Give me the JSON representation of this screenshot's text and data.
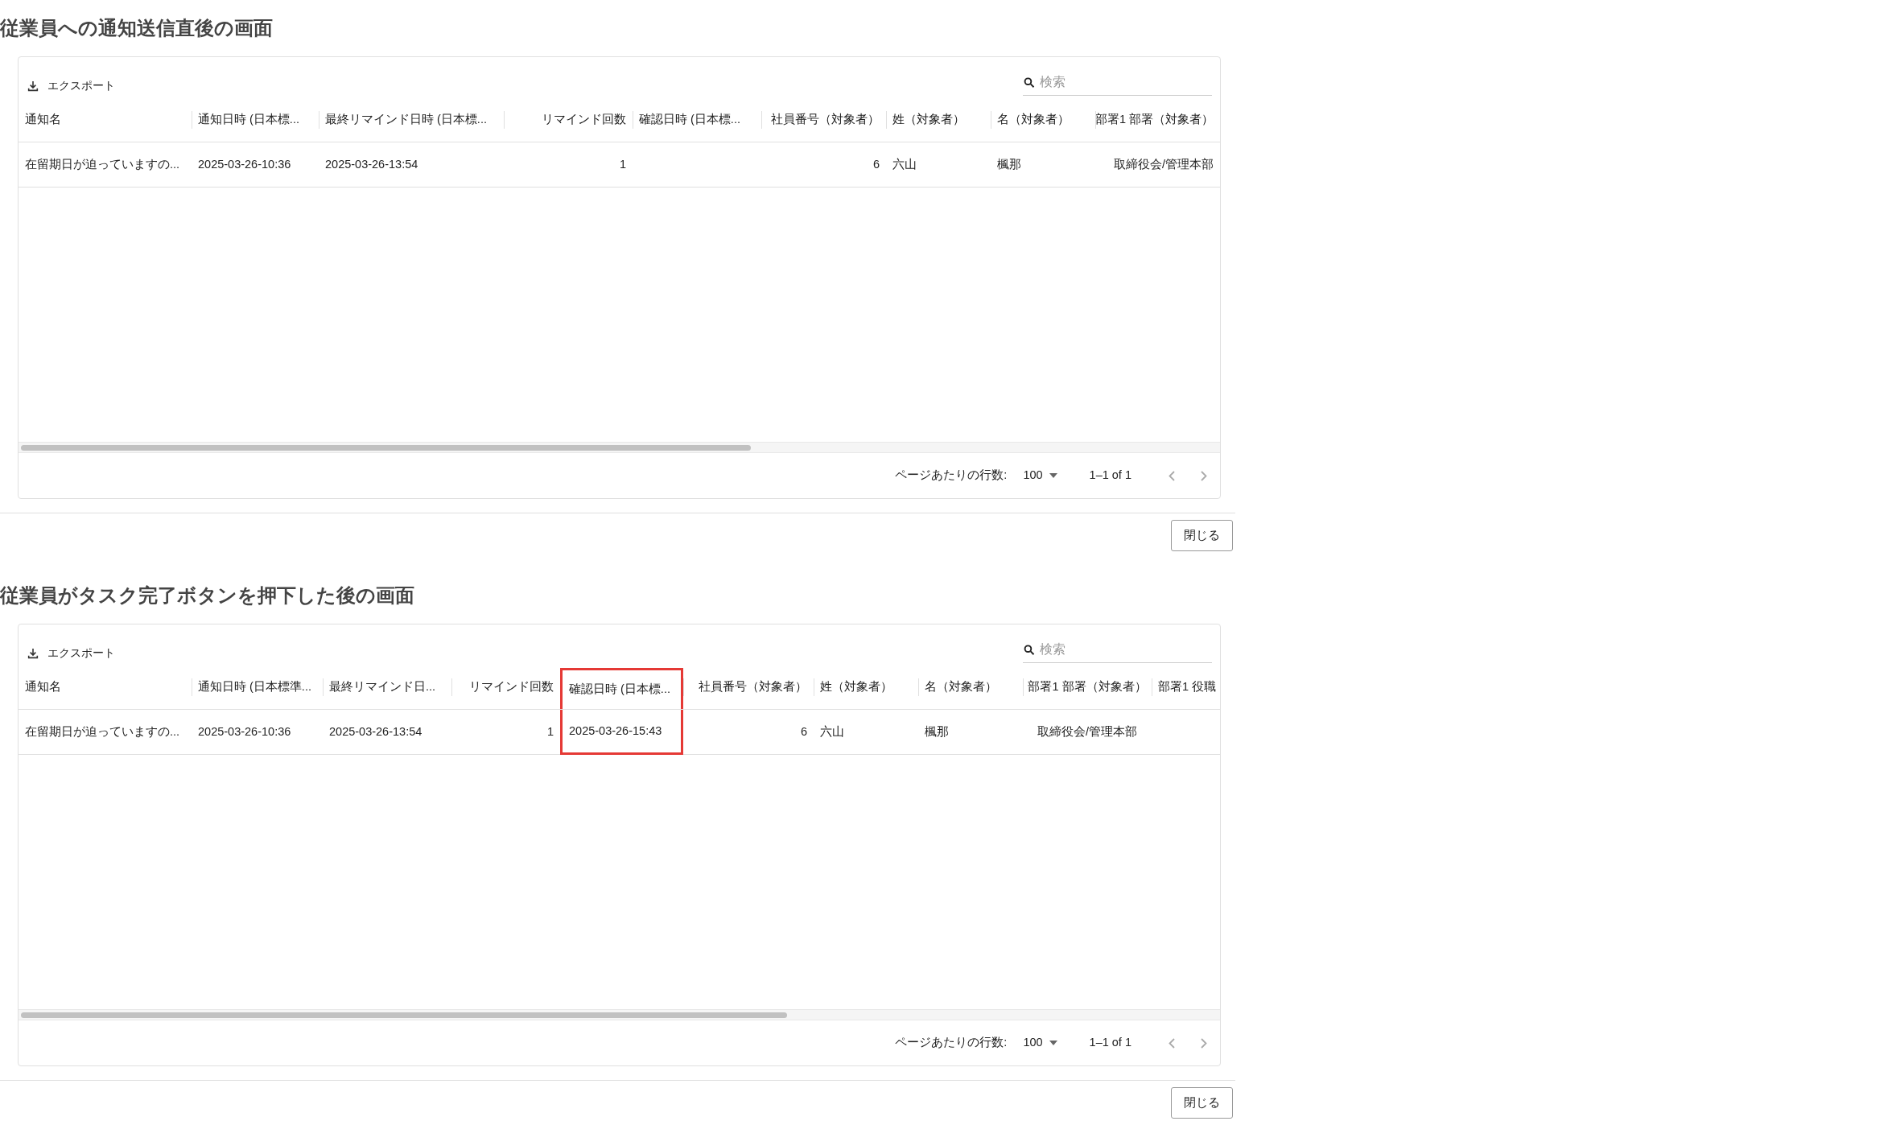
{
  "sections": [
    {
      "heading": "従業員への通知送信直後の画面",
      "grid": {
        "export_label": "エクスポート",
        "search": {
          "placeholder": "検索"
        },
        "columns": [
          {
            "label": "通知名",
            "highlighted": false
          },
          {
            "label": "通知日時 (日本標...",
            "highlighted": false
          },
          {
            "label": "最終リマインド日時 (日本標...",
            "highlighted": false
          },
          {
            "label": "リマインド回数",
            "highlighted": false
          },
          {
            "label": "確認日時 (日本標...",
            "highlighted": false
          },
          {
            "label": "社員番号（対象者）",
            "highlighted": false
          },
          {
            "label": "姓（対象者）",
            "highlighted": false
          },
          {
            "label": "名（対象者）",
            "highlighted": false
          },
          {
            "label": "部署1 部署（対象者）",
            "highlighted": false
          }
        ],
        "rows": [
          [
            "在留期日が迫っていますの...",
            "2025-03-26-10:36",
            "2025-03-26-13:54",
            "1",
            "",
            "6",
            "六山",
            "楓那",
            "取締役会/管理本部"
          ]
        ],
        "footer": {
          "rows_per_page_label": "ページあたりの行数:",
          "rows_per_page": "100",
          "range": "1–1 of 1"
        }
      },
      "close_button": "閉じる"
    },
    {
      "heading": "従業員がタスク完了ボタンを押下した後の画面",
      "grid": {
        "export_label": "エクスポート",
        "search": {
          "placeholder": "検索"
        },
        "columns": [
          {
            "label": "通知名",
            "highlighted": false
          },
          {
            "label": "通知日時 (日本標準...",
            "highlighted": false
          },
          {
            "label": "最終リマインド日...",
            "highlighted": false
          },
          {
            "label": "リマインド回数",
            "highlighted": false
          },
          {
            "label": "確認日時 (日本標...",
            "highlighted": true
          },
          {
            "label": "社員番号（対象者）",
            "highlighted": false
          },
          {
            "label": "姓（対象者）",
            "highlighted": false
          },
          {
            "label": "名（対象者）",
            "highlighted": false
          },
          {
            "label": "部署1 部署（対象者）",
            "highlighted": false
          },
          {
            "label": "部署1 役職",
            "highlighted": false
          }
        ],
        "rows": [
          [
            "在留期日が迫っていますの...",
            "2025-03-26-10:36",
            "2025-03-26-13:54",
            "1",
            "2025-03-26-15:43",
            "6",
            "六山",
            "楓那",
            "取締役会/管理本部",
            ""
          ]
        ],
        "footer": {
          "rows_per_page_label": "ページあたりの行数:",
          "rows_per_page": "100",
          "range": "1–1 of 1"
        }
      },
      "close_button": "閉じる"
    }
  ]
}
